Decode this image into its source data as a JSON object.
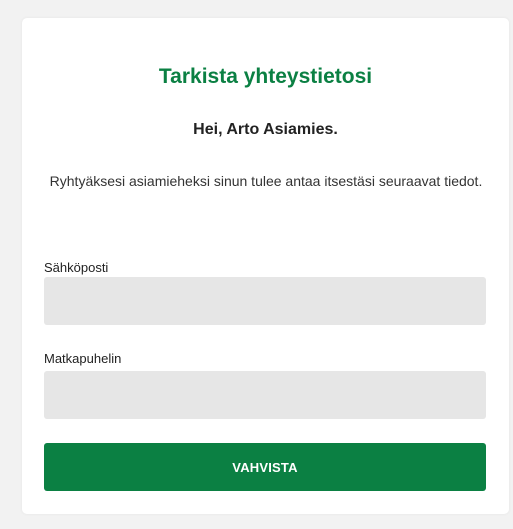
{
  "form": {
    "title": "Tarkista yhteystietosi",
    "greeting": "Hei, Arto Asiamies.",
    "intro": "Ryhtyäksesi asiamieheksi sinun tulee antaa itsestäsi seuraavat tiedot.",
    "email": {
      "label": "Sähköposti",
      "value": "",
      "placeholder": ""
    },
    "phone": {
      "label": "Matkapuhelin",
      "value": "",
      "placeholder": ""
    },
    "confirm_label": "VAHVISTA"
  },
  "colors": {
    "accent": "#0b8043",
    "input_background": "#e6e6e6",
    "page_background": "#f2f2f2"
  }
}
